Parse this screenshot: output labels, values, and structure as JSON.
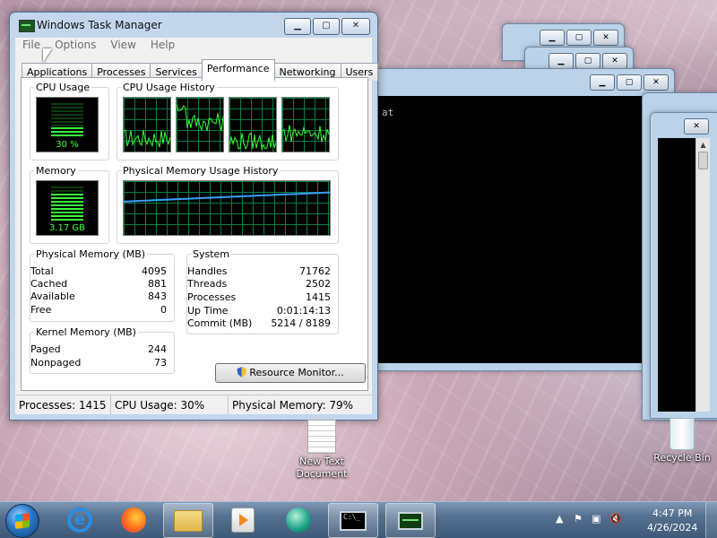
{
  "task_manager": {
    "title": "Windows Task Manager",
    "menu": [
      "File",
      "Options",
      "View",
      "Help"
    ],
    "tabs": [
      "Applications",
      "Processes",
      "Services",
      "Performance",
      "Networking",
      "Users"
    ],
    "active_tab": "Performance",
    "cpu_usage": {
      "label": "CPU Usage",
      "value": "30 %",
      "level": 0.3
    },
    "cpu_history": {
      "label": "CPU Usage History",
      "cores": 4
    },
    "memory": {
      "label": "Memory",
      "value": "3.17 GB",
      "level": 0.79
    },
    "memory_history": {
      "label": "Physical Memory Usage History"
    },
    "physical_memory": {
      "label": "Physical Memory (MB)",
      "rows": [
        {
          "k": "Total",
          "v": "4095"
        },
        {
          "k": "Cached",
          "v": "881"
        },
        {
          "k": "Available",
          "v": "843"
        },
        {
          "k": "Free",
          "v": "0"
        }
      ]
    },
    "kernel_memory": {
      "label": "Kernel Memory (MB)",
      "rows": [
        {
          "k": "Paged",
          "v": "244"
        },
        {
          "k": "Nonpaged",
          "v": "73"
        }
      ]
    },
    "system": {
      "label": "System",
      "rows": [
        {
          "k": "Handles",
          "v": "71762"
        },
        {
          "k": "Threads",
          "v": "2502"
        },
        {
          "k": "Processes",
          "v": "1415"
        },
        {
          "k": "Up Time",
          "v": "0:01:14:13"
        },
        {
          "k": "Commit (MB)",
          "v": "5214 / 8189"
        }
      ]
    },
    "resource_monitor_label": "Resource Monitor...",
    "status": {
      "processes": "Processes: 1415",
      "cpu": "CPU Usage: 30%",
      "memory": "Physical Memory: 79%"
    }
  },
  "console": {
    "text": "at"
  },
  "desktop": {
    "icons": [
      {
        "label": "New Text Document"
      },
      {
        "label": "Recycle Bin"
      }
    ]
  },
  "taskbar": {
    "time": "4:47 PM",
    "date": "4/26/2024"
  },
  "colors": {
    "graph_green": "#39ff39",
    "graph_grid": "#008040",
    "memory_line": "#3aa0ff"
  }
}
